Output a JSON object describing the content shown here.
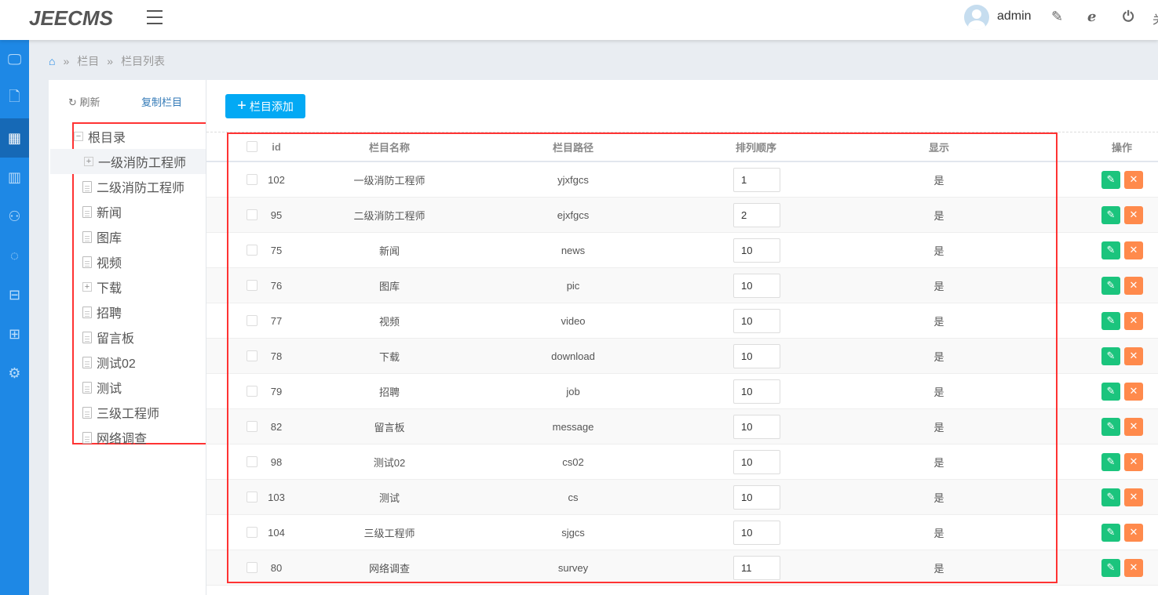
{
  "header": {
    "logo": "JEECMS",
    "username": "admin",
    "cut_text": "关"
  },
  "sidebar": {
    "items": [
      "monitor",
      "document",
      "grid",
      "chart",
      "user",
      "sync",
      "box",
      "apps",
      "settings"
    ],
    "active": 2
  },
  "breadcrumb": [
    "栏目",
    "栏目列表"
  ],
  "left": {
    "refresh": "刷新",
    "copy": "复制栏目",
    "root": "根目录",
    "nodes": [
      {
        "label": "一级消防工程师",
        "type": "folder"
      },
      {
        "label": "二级消防工程师",
        "type": "doc"
      },
      {
        "label": "新闻",
        "type": "doc"
      },
      {
        "label": "图库",
        "type": "doc"
      },
      {
        "label": "视频",
        "type": "doc"
      },
      {
        "label": "下载",
        "type": "folder"
      },
      {
        "label": "招聘",
        "type": "doc"
      },
      {
        "label": "留言板",
        "type": "doc"
      },
      {
        "label": "测试02",
        "type": "doc"
      },
      {
        "label": "测试",
        "type": "doc"
      },
      {
        "label": "三级工程师",
        "type": "doc"
      },
      {
        "label": "网络调查",
        "type": "doc"
      }
    ]
  },
  "toolbar": {
    "add": "栏目添加"
  },
  "table": {
    "headers": [
      "id",
      "栏目名称",
      "栏目路径",
      "排列顺序",
      "显示",
      "操作"
    ],
    "rows": [
      [
        "102",
        "一级消防工程师",
        "yjxfgcs",
        "1",
        "是"
      ],
      [
        "95",
        "二级消防工程师",
        "ejxfgcs",
        "2",
        "是"
      ],
      [
        "75",
        "新闻",
        "news",
        "10",
        "是"
      ],
      [
        "76",
        "图库",
        "pic",
        "10",
        "是"
      ],
      [
        "77",
        "视频",
        "video",
        "10",
        "是"
      ],
      [
        "78",
        "下载",
        "download",
        "10",
        "是"
      ],
      [
        "79",
        "招聘",
        "job",
        "10",
        "是"
      ],
      [
        "82",
        "留言板",
        "message",
        "10",
        "是"
      ],
      [
        "98",
        "测试02",
        "cs02",
        "10",
        "是"
      ],
      [
        "103",
        "测试",
        "cs",
        "10",
        "是"
      ],
      [
        "104",
        "三级工程师",
        "sjgcs",
        "10",
        "是"
      ],
      [
        "80",
        "网络调查",
        "survey",
        "11",
        "是"
      ]
    ]
  }
}
